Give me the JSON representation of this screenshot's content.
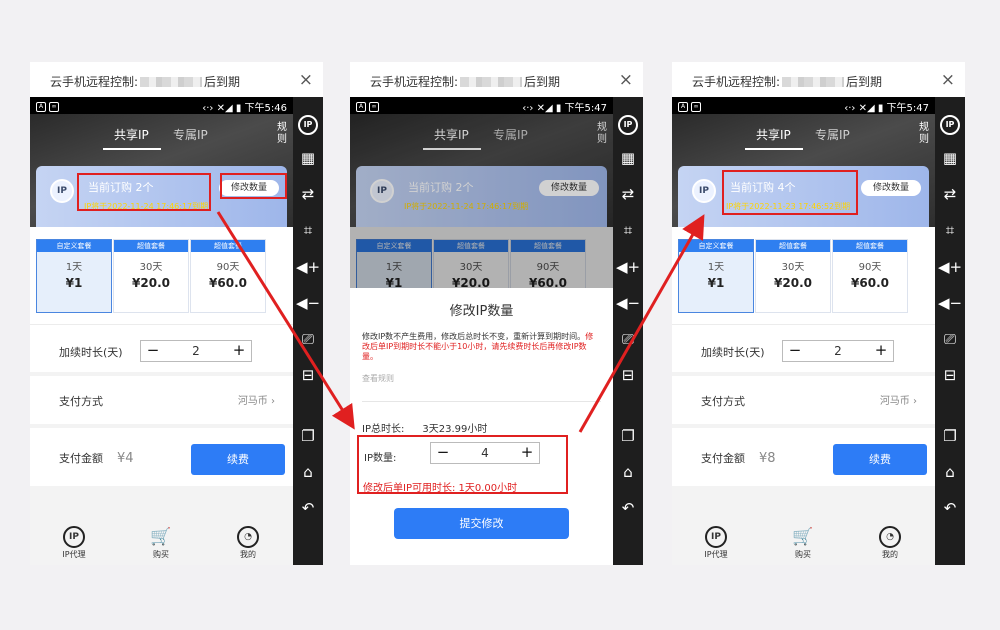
{
  "windows": [
    {
      "title_prefix": "云手机远程控制:",
      "title_suffix": "后到期",
      "close_label": "×",
      "time": "下午5:46",
      "signal": "‹·› ✕◢ ▮",
      "tabs": [
        "共享IP",
        "专属IP"
      ],
      "rule_label": "规则",
      "badge": "IP",
      "order_title": "当前订购 2个",
      "order_expire": "IP将于2022-11-24 17:46:17到期",
      "modify_label": "修改数量",
      "packages": [
        {
          "head": "自定义套餐",
          "duration": "1天",
          "price": "¥1"
        },
        {
          "head": "超值套餐",
          "duration": "30天",
          "price": "¥20.0"
        },
        {
          "head": "超值套餐",
          "duration": "90天",
          "price": "¥60.0"
        }
      ],
      "renew_label": "加续时长(天)",
      "renew_value": "2",
      "pay_label": "支付方式",
      "pay_value": "河马币",
      "amount_label": "支付金额",
      "amount_value": "¥4",
      "renew_button": "续费",
      "nav": [
        "IP代理",
        "购买",
        "我的"
      ],
      "minus": "−",
      "plus": "+"
    },
    {
      "title_prefix": "云手机远程控制:",
      "title_suffix": "后到期",
      "close_label": "×",
      "time": "下午5:47",
      "signal": "‹·› ✕◢ ▮",
      "tabs": [
        "共享IP",
        "专属IP"
      ],
      "rule_label": "规则",
      "badge": "IP",
      "order_title": "当前订购 2个",
      "order_expire": "IP将于2022-11-24 17:46:17到期",
      "modify_label": "修改数量",
      "packages": [
        {
          "head": "自定义套餐",
          "duration": "1天",
          "price": "¥1"
        },
        {
          "head": "超值套餐",
          "duration": "30天",
          "price": "¥20.0"
        },
        {
          "head": "超值套餐",
          "duration": "90天",
          "price": "¥60.0"
        }
      ],
      "modal": {
        "title": "修改IP数量",
        "desc1": "修改IP数不产生费用，修改后总时长不变，重新计算到期时间。",
        "desc2": "修改后单IP到期时长不能小于10小时，请先续费时长后再修改IP数量。",
        "link": "查看规则",
        "total_label": "IP总时长:",
        "total_value": "3天23.99小时",
        "qty_label": "IP数量:",
        "qty_value": "4",
        "warn": "修改后单IP可用时长: 1天0.00小时",
        "submit": "提交修改"
      },
      "minus": "−",
      "plus": "+"
    },
    {
      "title_prefix": "云手机远程控制:",
      "title_suffix": "后到期",
      "close_label": "×",
      "time": "下午5:47",
      "signal": "‹·› ✕◢ ▮",
      "tabs": [
        "共享IP",
        "专属IP"
      ],
      "rule_label": "规则",
      "badge": "IP",
      "order_title": "当前订购 4个",
      "order_expire": "IP将于2022-11-23 17:46:52到期",
      "modify_label": "修改数量",
      "packages": [
        {
          "head": "自定义套餐",
          "duration": "1天",
          "price": "¥1"
        },
        {
          "head": "超值套餐",
          "duration": "30天",
          "price": "¥20.0"
        },
        {
          "head": "超值套餐",
          "duration": "90天",
          "price": "¥60.0"
        }
      ],
      "renew_label": "加续时长(天)",
      "renew_value": "2",
      "pay_label": "支付方式",
      "pay_value": "河马币",
      "amount_label": "支付金额",
      "amount_value": "¥8",
      "renew_button": "续费",
      "nav": [
        "IP代理",
        "购买",
        "我的"
      ],
      "minus": "−",
      "plus": "+"
    }
  ],
  "sidebar_icons": [
    "ip-icon",
    "qrcode-icon",
    "cast-icon",
    "crop-icon",
    "volume-up-icon",
    "volume-down-icon",
    "screenshot-icon",
    "scan-icon",
    "copy-icon",
    "home-icon",
    "back-icon"
  ],
  "colors": {
    "accent": "#2d7cf6",
    "highlight": "#e02020",
    "expire_text": "#ffd400"
  }
}
